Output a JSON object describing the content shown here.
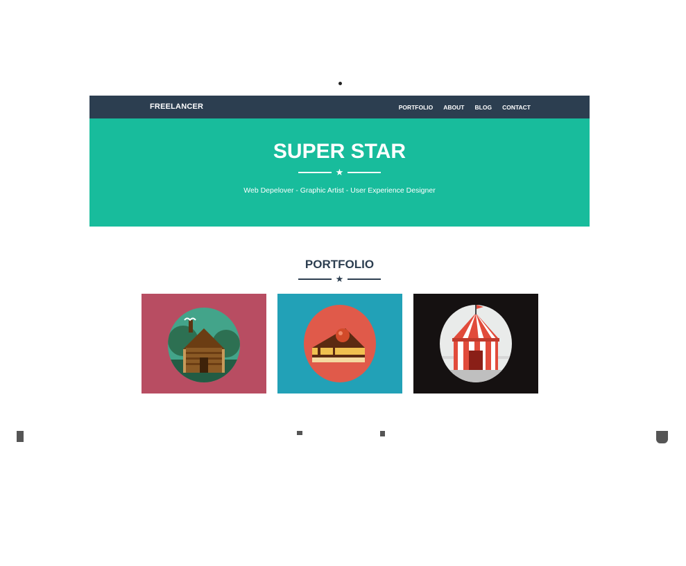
{
  "navbar": {
    "brand": "FREELANCER",
    "links": [
      "PORTFOLIO",
      "ABOUT",
      "BLOG",
      "CONTACT"
    ]
  },
  "hero": {
    "title": "SUPER STAR",
    "subtitle": "Web Depelover - Graphic Artist - User Experience Designer"
  },
  "portfolio": {
    "title": "PORTFOLIO",
    "items": [
      {
        "icon": "cabin-icon",
        "bg": "#b84d62",
        "circle": "#43a48a"
      },
      {
        "icon": "cake-icon",
        "bg": "#22a1b7",
        "circle": "#e05a4a"
      },
      {
        "icon": "circus-tent-icon",
        "bg": "#151111",
        "circle": "#e9ebea"
      }
    ]
  },
  "colors": {
    "navbar": "#2c3e50",
    "hero": "#18bc9c",
    "heading": "#2c3e50"
  }
}
